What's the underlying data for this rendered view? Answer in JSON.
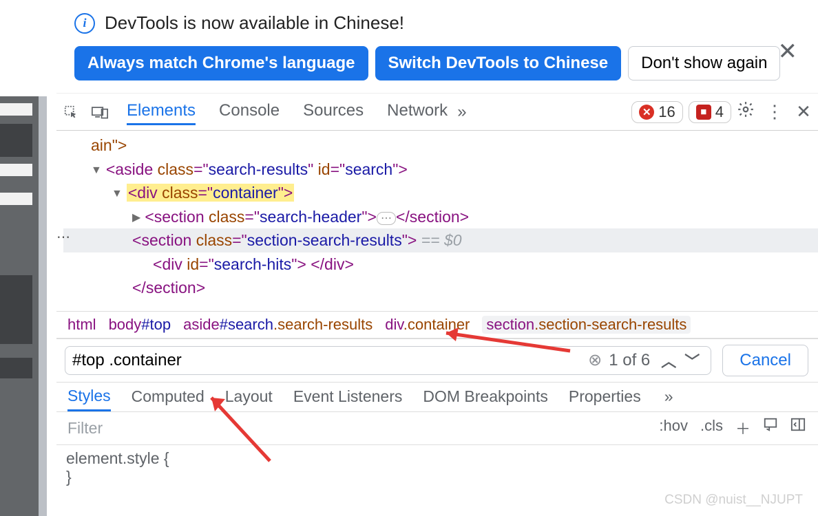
{
  "notice": {
    "message": "DevTools is now available in Chinese!",
    "btn_match": "Always match Chrome's language",
    "btn_switch": "Switch DevTools to Chinese",
    "btn_dismiss": "Don't show again"
  },
  "tabs": {
    "elements": "Elements",
    "console": "Console",
    "sources": "Sources",
    "network": "Network",
    "more": "»"
  },
  "counts": {
    "errors": "16",
    "issues": "4"
  },
  "dom": {
    "l0": "ain\">",
    "l1_open": "<aside class=\"search-results\" id=\"search\">",
    "l2_hl": "<div class=\"container\">",
    "l3_a": "<section class=\"search-header\">",
    "l3_b": "</section>",
    "l4": "<section class=\"section-search-results\">",
    "l4_sel": " == $0",
    "l5": "<div id=\"search-hits\"> </div>",
    "l6": "</section>"
  },
  "crumbs": {
    "c1": "html",
    "c2_tag": "body",
    "c2_id": "#top",
    "c3_tag": "aside",
    "c3_id": "#search",
    "c3_cls": ".search-results",
    "c4_tag": "div",
    "c4_cls": ".container",
    "c5_tag": "section",
    "c5_cls": ".section-search-results"
  },
  "search": {
    "value": "#top .container ",
    "count": "1 of 6",
    "cancel": "Cancel"
  },
  "subtabs": {
    "styles": "Styles",
    "computed": "Computed",
    "layout": "Layout",
    "listeners": "Event Listeners",
    "dombp": "DOM Breakpoints",
    "props": "Properties",
    "more": "»"
  },
  "filter": {
    "placeholder": "Filter",
    "hov": ":hov",
    "cls": ".cls"
  },
  "style_block": {
    "sel": "element.style {",
    "close": "}"
  },
  "watermark": "CSDN @nuist__NJUPT"
}
